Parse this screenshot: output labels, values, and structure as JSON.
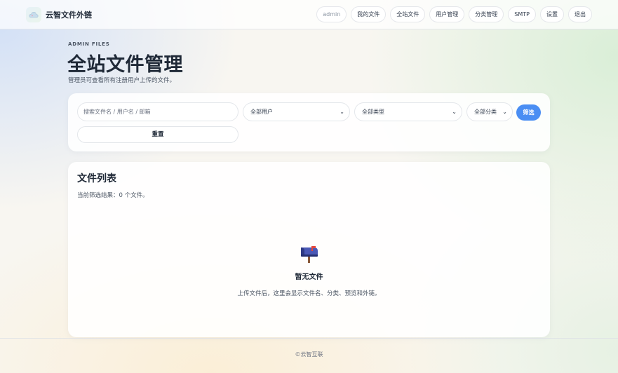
{
  "brand": {
    "name": "云智文件外链"
  },
  "nav": {
    "user": "admin",
    "items": [
      "我的文件",
      "全站文件",
      "用户管理",
      "分类管理",
      "SMTP",
      "设置",
      "退出"
    ]
  },
  "header": {
    "eyebrow": "ADMIN FILES",
    "title": "全站文件管理",
    "description": "管理员可查看所有注册用户上传的文件。"
  },
  "filters": {
    "search_placeholder": "搜索文件名 / 用户名 / 邮箱",
    "search_value": "",
    "user_select": "全部用户",
    "type_select": "全部类型",
    "category_select": "全部分类",
    "filter_button": "筛选",
    "reset_button": "重置"
  },
  "file_list": {
    "title": "文件列表",
    "count_text": "当前筛选结果：0 个文件。",
    "empty_title": "暂无文件",
    "empty_desc": "上传文件后，这里会显示文件名、分类、预览和外链。",
    "empty_icon": "mailbox-icon"
  },
  "footer": {
    "text": "©云智互联"
  },
  "colors": {
    "accent": "#4a8ef3",
    "text": "#1f2937"
  }
}
